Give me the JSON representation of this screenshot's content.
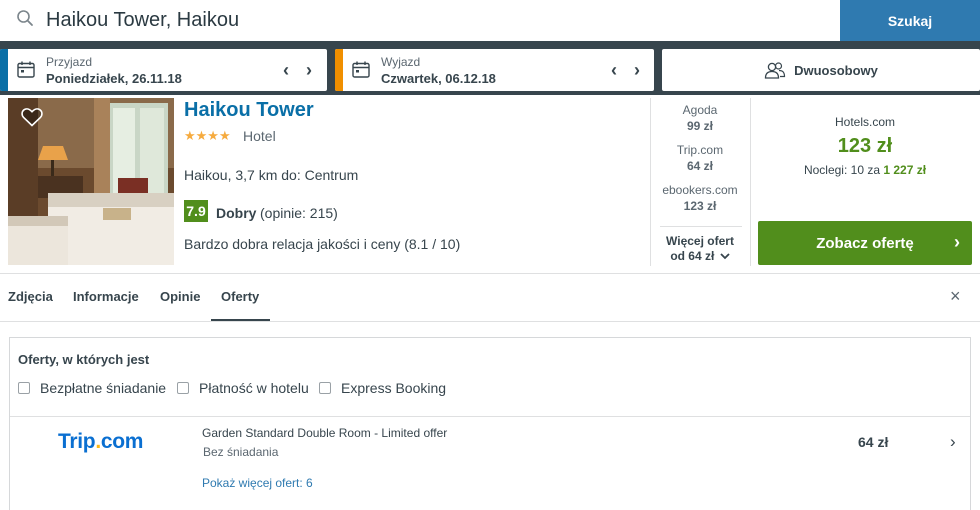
{
  "search": {
    "query": "Haikou Tower, Haikou",
    "button_label": "Szukaj",
    "icon": "search-icon"
  },
  "dates": {
    "checkin": {
      "label": "Przyjazd",
      "value": "Poniedziałek, 26.11.18",
      "accent": "#0a6fa7"
    },
    "checkout": {
      "label": "Wyjazd",
      "value": "Czwartek, 06.12.18",
      "accent": "#f08f00"
    },
    "arrows": "‹ ›"
  },
  "room": {
    "label": "Dwuosobowy",
    "icon": "users-icon"
  },
  "hotel": {
    "name": "Haikou Tower",
    "stars": "★★★★",
    "type": "Hotel",
    "location": "Haikou, 3,7 km do: Centrum",
    "rating_score": "7.9",
    "rating_word": "Dobry",
    "rating_count": "(opinie: 215)",
    "value_text": "Bardzo dobra relacja jakości i ceny (8.1 / 10)"
  },
  "offers": [
    {
      "site": "Agoda",
      "price": "99 zł"
    },
    {
      "site": "Trip.com",
      "price": "64 zł"
    },
    {
      "site": "ebookers.com",
      "price": "123 zł"
    }
  ],
  "more_offers": {
    "line1": "Więcej ofert",
    "line2": "od 64 zł"
  },
  "best": {
    "site": "Hotels.com",
    "price": "123 zł",
    "nights_prefix": "Noclegi: 10 za",
    "nights_total": "1 227 zł",
    "cta_label": "Zobacz ofertę",
    "cta_chevron": "›"
  },
  "tabs": [
    "Zdjęcia",
    "Informacje",
    "Opinie",
    "Oferty"
  ],
  "active_tab": "Oferty",
  "close_glyph": "×",
  "deals": {
    "title": "Oferty, w których jest",
    "filters": [
      "Bezpłatne śniadanie",
      "Płatność w hotelu",
      "Express Booking"
    ],
    "item": {
      "logo_main": "Trip",
      "logo_dot": ".",
      "logo_tail": "com",
      "room": "Garden Standard Double Room - Limited offer",
      "meal": "Bez śniadania",
      "more": "Pokaż więcej ofert: 6",
      "price": "64 zł",
      "chevron": "›"
    }
  },
  "colors": {
    "dark": "#37454d",
    "blue": "#0a6fa7",
    "green": "#518e1c",
    "orange": "#f08f00",
    "search_button": "#2f7ab0"
  }
}
